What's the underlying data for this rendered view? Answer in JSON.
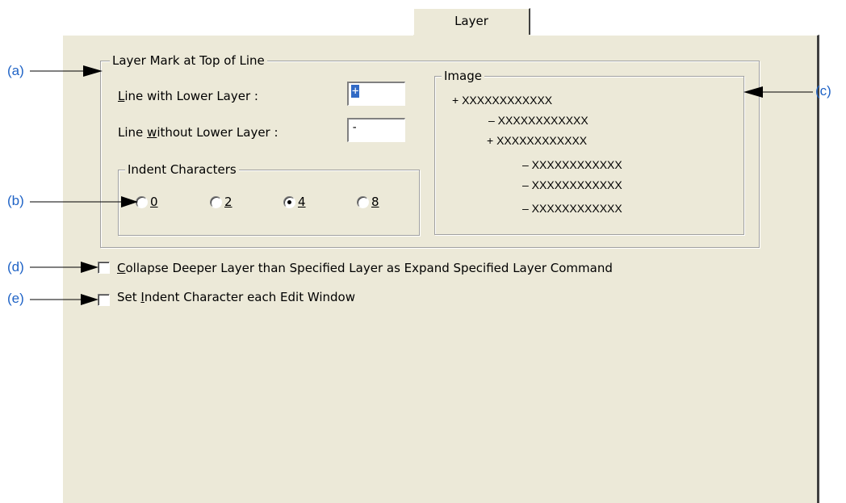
{
  "tab": {
    "label": "Layer"
  },
  "layer_mark": {
    "title": "Layer Mark at Top of Line",
    "with_lower_prefix": "L",
    "with_lower_rest": "ine with Lower Layer :",
    "with_lower_value": "+",
    "without_lower_a": "Line ",
    "without_lower_u": "w",
    "without_lower_b": "ithout Lower Layer :",
    "without_lower_value": "-"
  },
  "indent": {
    "title": "Indent Characters",
    "options": [
      {
        "label": "0",
        "selected": false
      },
      {
        "label": "2",
        "selected": false
      },
      {
        "label": "4",
        "selected": true
      },
      {
        "label": "8",
        "selected": false
      }
    ]
  },
  "image": {
    "title": "Image",
    "lines": [
      "+ XXXXXXXXXXXX",
      "– XXXXXXXXXXXX",
      "+ XXXXXXXXXXXX",
      "– XXXXXXXXXXXX",
      "– XXXXXXXXXXXX",
      "– XXXXXXXXXXXX"
    ]
  },
  "options": {
    "collapse_u": "C",
    "collapse_rest": "ollapse Deeper Layer than Specified Layer as Expand Specified Layer Command",
    "collapse_checked": false,
    "indent_a": "Set ",
    "indent_u": "I",
    "indent_b": "ndent Character each Edit Window",
    "indent_checked": false
  },
  "callouts": {
    "a": "(a)",
    "b": "(b)",
    "c": "(c)",
    "d": "(d)",
    "e": "(e)"
  },
  "colors": {
    "callout": "#1f63c6",
    "dialog_bg": "#ece9d8",
    "selection": "#316ac5"
  }
}
